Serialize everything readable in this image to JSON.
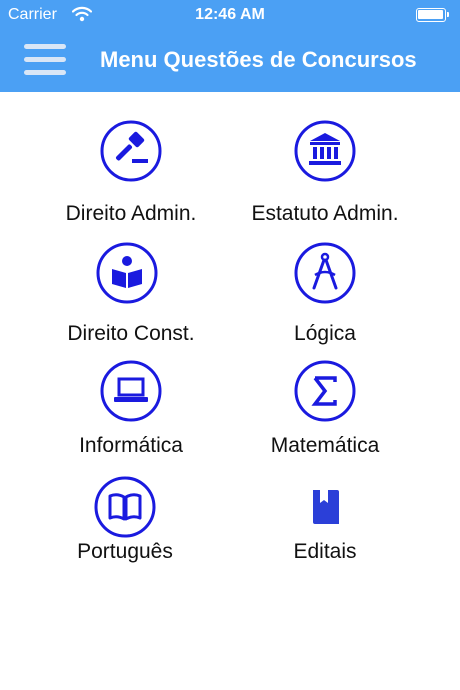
{
  "status_bar": {
    "carrier": "Carrier",
    "time": "12:46 AM"
  },
  "header": {
    "title": "Menu Questões de Concursos",
    "background_color": "#4ba0f4",
    "menu_icon": "hamburger-icon"
  },
  "accent_color": "#1a1adf",
  "menu": [
    {
      "label": "Direito Admin.",
      "icon": "gavel-icon"
    },
    {
      "label": "Estatuto Admin.",
      "icon": "bank-icon"
    },
    {
      "label": "Direito Const.",
      "icon": "book-reader-icon"
    },
    {
      "label": "Lógica",
      "icon": "compass-icon"
    },
    {
      "label": "Informática",
      "icon": "laptop-icon"
    },
    {
      "label": "Matemática",
      "icon": "sigma-icon"
    },
    {
      "label": "Português",
      "icon": "open-book-icon"
    },
    {
      "label": "Editais",
      "icon": "bookmark-book-icon"
    }
  ]
}
